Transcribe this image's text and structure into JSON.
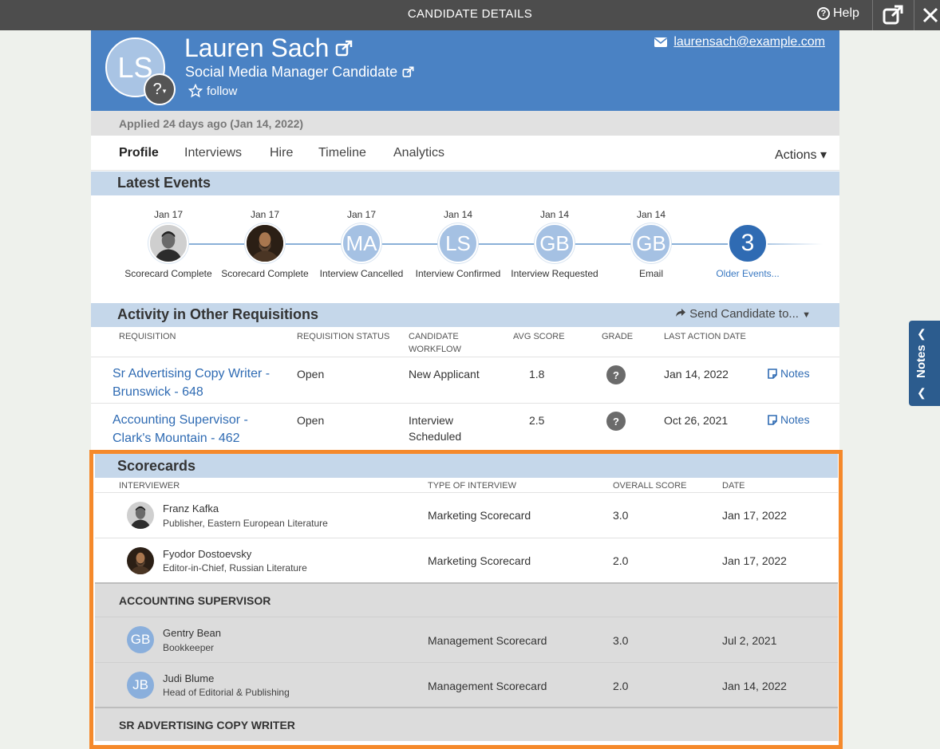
{
  "topbar": {
    "title": "CANDIDATE DETAILS",
    "help": "Help"
  },
  "candidate": {
    "initials": "LS",
    "avatar_badge": "?",
    "name": "Lauren Sach",
    "role": "Social Media Manager Candidate",
    "follow": "follow",
    "email": "laurensach@example.com",
    "applied": "Applied 24 days ago (Jan 14, 2022)"
  },
  "tabs": [
    {
      "label": "Profile",
      "active": true
    },
    {
      "label": "Interviews"
    },
    {
      "label": "Hire"
    },
    {
      "label": "Timeline"
    },
    {
      "label": "Analytics"
    }
  ],
  "actions_label": "Actions",
  "latest_events": {
    "title": "Latest Events",
    "events": [
      {
        "date": "Jan 17",
        "avatar": "photo-kafka",
        "label": "Scorecard Complete"
      },
      {
        "date": "Jan 17",
        "avatar": "photo-dostoevsky",
        "label": "Scorecard Complete"
      },
      {
        "date": "Jan 17",
        "initials": "MA",
        "label": "Interview Cancelled"
      },
      {
        "date": "Jan 14",
        "initials": "LS",
        "label": "Interview Confirmed"
      },
      {
        "date": "Jan 14",
        "initials": "GB",
        "label": "Interview Requested"
      },
      {
        "date": "Jan 14",
        "initials": "GB",
        "label": "Email"
      },
      {
        "date": "",
        "count": "3",
        "label": "Older Events..."
      }
    ]
  },
  "other_reqs": {
    "title": "Activity in Other Requisitions",
    "send_label": "Send Candidate to...",
    "columns": [
      "REQUISITION",
      "REQUISITION STATUS",
      "CANDIDATE WORKFLOW",
      "AVG SCORE",
      "GRADE",
      "LAST ACTION DATE"
    ],
    "rows": [
      {
        "name": "Sr Advertising Copy Writer - Brunswick - 648",
        "status": "Open",
        "workflow": "New Applicant",
        "avg": "1.8",
        "grade": "?",
        "date": "Jan 14, 2022",
        "notes": "Notes"
      },
      {
        "name": "Accounting Supervisor - Clark's Mountain - 462",
        "status": "Open",
        "workflow": "Interview Scheduled",
        "avg": "2.5",
        "grade": "?",
        "date": "Oct 26, 2021",
        "notes": "Notes"
      }
    ]
  },
  "scorecards": {
    "title": "Scorecards",
    "columns": [
      "INTERVIEWER",
      "TYPE OF INTERVIEW",
      "OVERALL SCORE",
      "DATE"
    ],
    "rows": [
      {
        "name": "Franz Kafka",
        "title": "Publisher, Eastern European Literature",
        "type": "Marketing Scorecard",
        "score": "3.0",
        "date": "Jan 17, 2022"
      },
      {
        "name": "Fyodor Dostoevsky",
        "title": "Editor-in-Chief, Russian Literature",
        "type": "Marketing Scorecard",
        "score": "2.0",
        "date": "Jan 17, 2022"
      }
    ],
    "groups": [
      {
        "label": "ACCOUNTING SUPERVISOR",
        "rows": [
          {
            "initials": "GB",
            "name": "Gentry Bean",
            "title": "Bookkeeper",
            "type": "Management Scorecard",
            "score": "3.0",
            "date": "Jul 2, 2021"
          },
          {
            "initials": "JB",
            "name": "Judi Blume",
            "title": "Head of Editorial & Publishing",
            "type": "Management Scorecard",
            "score": "2.0",
            "date": "Jan 14, 2022"
          }
        ]
      },
      {
        "label": "SR ADVERTISING COPY WRITER"
      }
    ]
  },
  "notes_tab": "Notes",
  "colors": {
    "header_blue": "#4a82c4",
    "section_blue": "#c5d7ea",
    "link_blue": "#2f6bb3",
    "highlight": "#f5892b"
  }
}
